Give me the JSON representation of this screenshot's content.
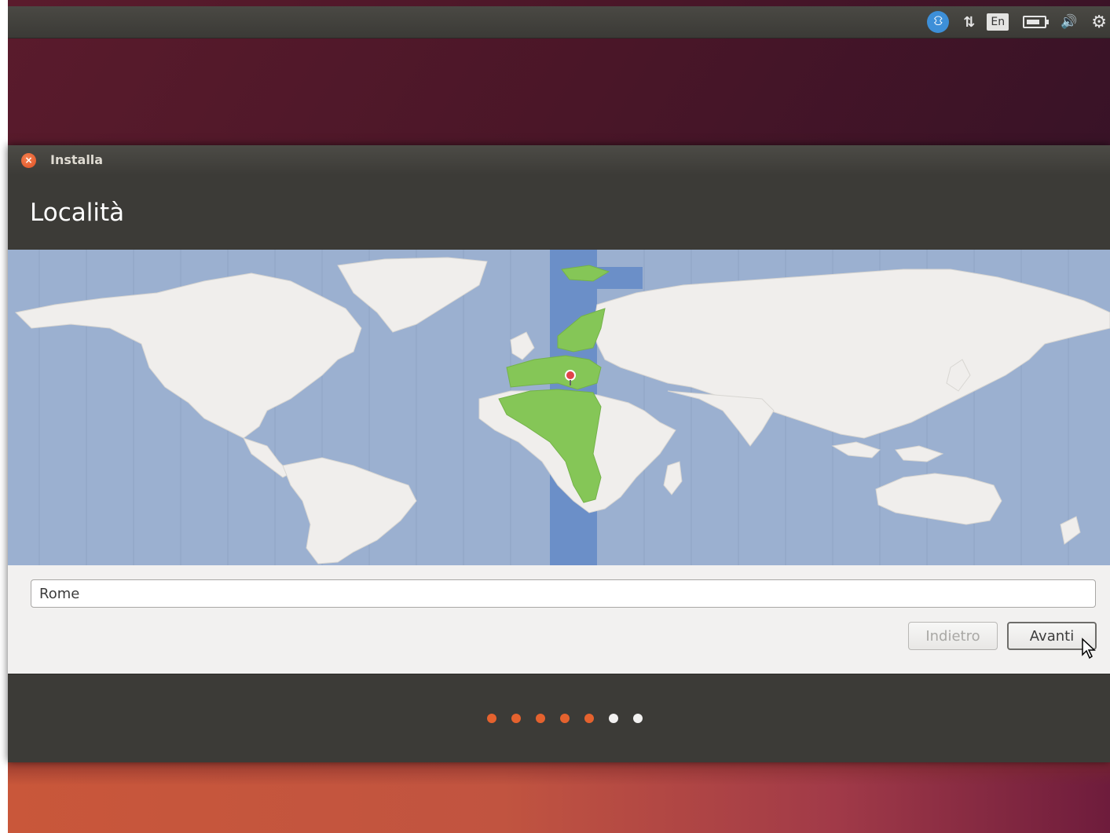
{
  "tray": {
    "accessibility_icon": "accessibility-icon",
    "network_icon": "network-arrows-icon",
    "keyboard_layout": "En",
    "battery_icon": "battery-icon",
    "volume_icon": "volume-icon",
    "settings_icon": "gear-icon"
  },
  "window": {
    "title": "Installa",
    "page_title": "Località",
    "location_value": "Rome",
    "back_label": "Indietro",
    "next_label": "Avanti"
  },
  "map": {
    "selected_city": "Rome",
    "timezone_highlight_color": "#6b8fc8",
    "land_color": "#f0eeec",
    "selected_zone_color": "#85c657",
    "ocean_color": "#9bb0d0"
  },
  "progress": {
    "total_steps": 7,
    "completed_steps": 5,
    "active_color": "#e5622e",
    "inactive_color": "#f2f1f0"
  }
}
